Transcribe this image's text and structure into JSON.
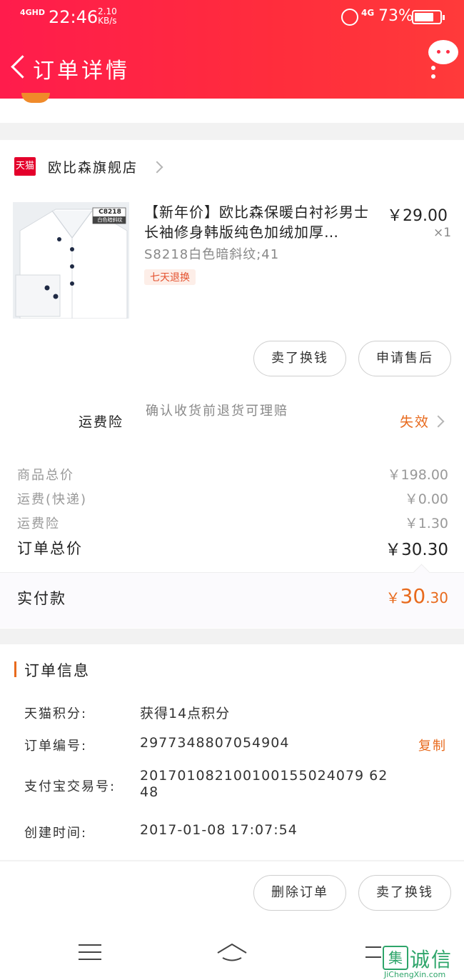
{
  "status_bar": {
    "signal": "4GHD",
    "time": "22:46",
    "speed_value": "2.10",
    "speed_unit": "KB/s",
    "network": "4G",
    "battery": "73%",
    "battery_level": 0.73
  },
  "header": {
    "title": "订单详情",
    "back_icon": "chevron-left-icon",
    "more_icon": "chat-bubble-more-icon"
  },
  "shop": {
    "logo_text": "天猫",
    "name": "欧比森旗舰店"
  },
  "product": {
    "title": "【新年价】欧比森保暖白衬衫男士长袖修身韩版纯色加绒加厚…",
    "price": "￥29.00",
    "quantity": "×1",
    "sku": "S8218白色暗斜纹;41",
    "tag": "七天退换",
    "image_label_code": "C8218",
    "image_label_desc": "白色暗斜纹"
  },
  "item_actions": {
    "sell_label": "卖了换钱",
    "after_sale_label": "申请售后"
  },
  "insurance": {
    "label": "运费险",
    "description": "确认收货前退货可理赔",
    "status": "失效"
  },
  "summary": {
    "rows": [
      {
        "label": "商品总价",
        "value": "￥198.00"
      },
      {
        "label": "运费(快递)",
        "value": "￥0.00"
      },
      {
        "label": "运费险",
        "value": "￥1.30"
      }
    ],
    "total_label": "订单总价",
    "total_value": "￥30.30",
    "paid_label": "实付款",
    "paid_currency": "￥",
    "paid_integer": "30",
    "paid_decimal": ".30"
  },
  "order_info": {
    "title": "订单信息",
    "points_key": "天猫积分:",
    "points_value": "获得14点积分",
    "order_no_key": "订单编号:",
    "order_no_value": "2977348807054904",
    "copy_label": "复制",
    "alipay_key": "支付宝交易号:",
    "alipay_value_line1": "201701082100100155024079 62",
    "alipay_value_line2": "48",
    "created_key": "创建时间:",
    "created_value": "2017-01-08 17:07:54"
  },
  "order_actions": {
    "delete_label": "删除订单",
    "sell_label": "卖了换钱"
  },
  "navbar": {
    "menu_icon": "menu-icon",
    "home_icon": "home-icon",
    "back_icon": "back-icon"
  },
  "watermark": {
    "mark": "集",
    "text": "诚信",
    "domain": "JiChengXin.com"
  },
  "colors": {
    "brand_red": "#ff1c4c",
    "accent_orange": "#e86a1d",
    "tmall_red": "#e4002b"
  }
}
